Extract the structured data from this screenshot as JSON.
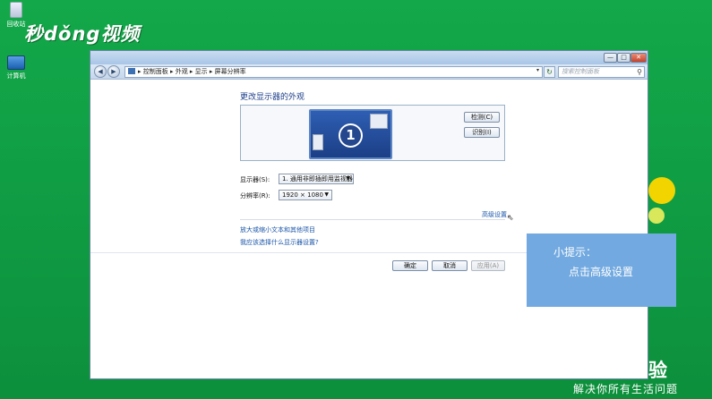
{
  "desktop": {
    "brand": "秒dǒng视频",
    "icons": [
      {
        "label": "回收站"
      },
      {
        "label": "计算机"
      }
    ],
    "slogan": "解决你所有生活问题",
    "watermark_fragment": "验"
  },
  "window": {
    "controls": {
      "minimize": "—",
      "maximize": "□",
      "close": "✕"
    },
    "nav": {
      "back": "◀",
      "forward": "▶"
    },
    "address": {
      "breadcrumb": "▸ 控制面板 ▸ 外观 ▸ 显示 ▸ 屏幕分辨率",
      "dropdown": "▾",
      "refresh": "↻"
    },
    "search": {
      "placeholder": "搜索控制面板",
      "icon": "search-icon"
    }
  },
  "content": {
    "title": "更改显示器的外观",
    "monitor_number": "1",
    "buttons": {
      "detect": "检测(C)",
      "identify": "识别(I)"
    },
    "display_label": "显示器(S):",
    "display_value": "1. 通用非即插即用监视器",
    "resolution_label": "分辨率(R):",
    "resolution_value": "1920 × 1080",
    "advanced_link": "高级设置",
    "links": {
      "enlarge": "放大或缩小文本和其他项目",
      "which": "我应该选择什么显示器设置?"
    },
    "footer": {
      "ok": "确定",
      "cancel": "取消",
      "apply": "应用(A)"
    }
  },
  "tip": {
    "title": "小提示：",
    "body": "点击高级设置"
  },
  "colors": {
    "desktop_green": "#13a84a",
    "tip_blue": "#72a9e0",
    "link_blue": "#1a55a8"
  }
}
